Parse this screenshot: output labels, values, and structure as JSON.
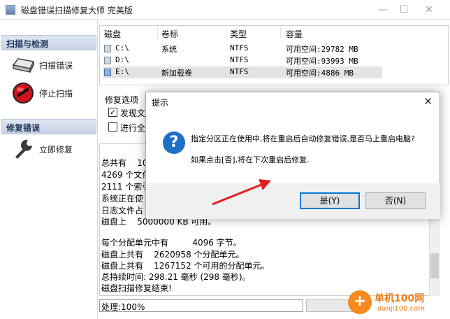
{
  "window": {
    "title": "磁盘错误扫描修复大师 完美版",
    "minimize_glyph": "—",
    "maximize_glyph": "☐",
    "close_glyph": "✕"
  },
  "sidebar": {
    "scan_group": "扫描与检测",
    "scan_button": "扫描错误",
    "stop_button": "停止扫描",
    "repair_group": "修复错误",
    "repair_button": "立即修复"
  },
  "drive_table": {
    "headers": [
      "磁盘",
      "卷标",
      "类型",
      "容量"
    ],
    "rows": [
      {
        "disk": "C:\\",
        "label": "系统",
        "type": "NTFS",
        "capacity": "可用空间:29782 MB",
        "selected": false
      },
      {
        "disk": "D:\\",
        "label": "",
        "type": "NTFS",
        "capacity": "可用空间:93993 MB",
        "selected": false
      },
      {
        "disk": "E:\\",
        "label": "新加载卷",
        "type": "NTFS",
        "capacity": "可用空间:4886 MB",
        "selected": true
      }
    ]
  },
  "options": {
    "title": "修复选项",
    "opt1_label": "发现文",
    "opt1_checked": "✓",
    "opt2_label": "进行全"
  },
  "log": {
    "lines": [
      "总共有    10",
      "4269 个文件",
      "2111 个索引",
      "系统正在使",
      "日志文件占",
      "磁盘上    5000000 KB 可用。",
      "",
      "每个分配单元中有         4096 字节。",
      "磁盘上共有    2620958 个分配单元。",
      "磁盘上共有    1267152 个可用的分配单元。",
      "总持续时间: 298.21 毫秒 (298 毫秒)。",
      "磁盘扫描修复结束!"
    ]
  },
  "status": {
    "text": "处理:100%"
  },
  "dialog": {
    "title": "提示",
    "close_glyph": "✕",
    "icon_glyph": "?",
    "message1": "指定分区正在使用中,将在重启后自动修复错误,是否马上重启电脑?",
    "message2": "如果点击[否],将在下次重启后修复.",
    "yes_label": "是(Y)",
    "no_label": "否(N)"
  },
  "watermark": {
    "glyph": "+",
    "site_name": "单机100网",
    "site_url": "danji100.com"
  },
  "colors": {
    "accent": "#0078d7",
    "arrow": "#e02020",
    "watermark": "#f07d12"
  }
}
